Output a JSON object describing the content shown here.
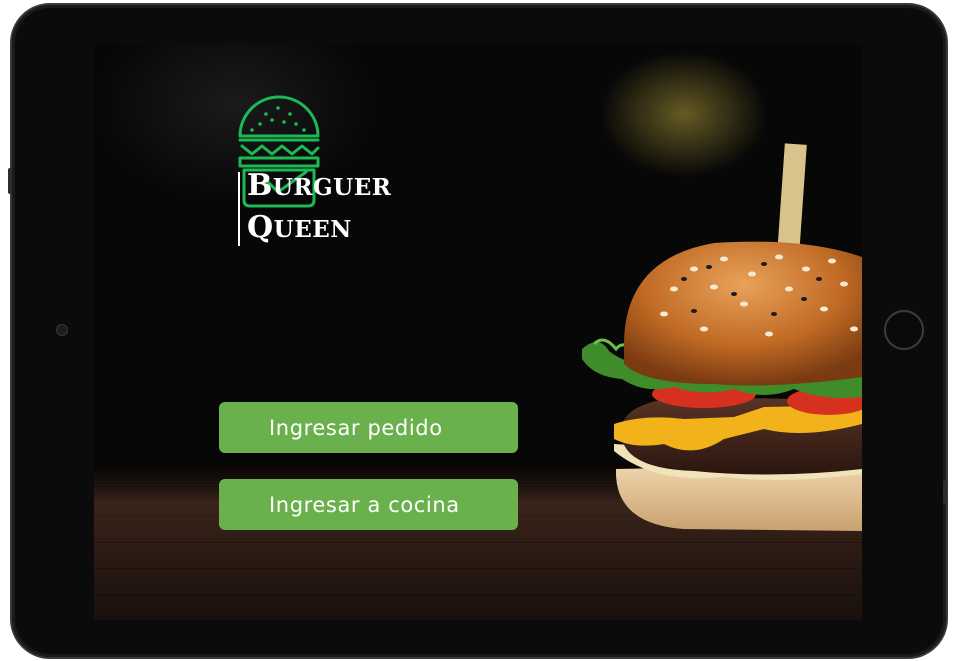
{
  "brand": {
    "line1": {
      "initial": "B",
      "rest": "URGUER"
    },
    "line2": {
      "initial": "Q",
      "rest": "UEEN"
    }
  },
  "actions": {
    "order_button_label": "Ingresar pedido",
    "kitchen_button_label": "Ingresar a cocina"
  },
  "colors": {
    "button_green": "#6ab04c",
    "logo_green": "#1db954",
    "text_white": "#ffffff"
  },
  "icons": {
    "logo": "burger-logo-icon"
  }
}
